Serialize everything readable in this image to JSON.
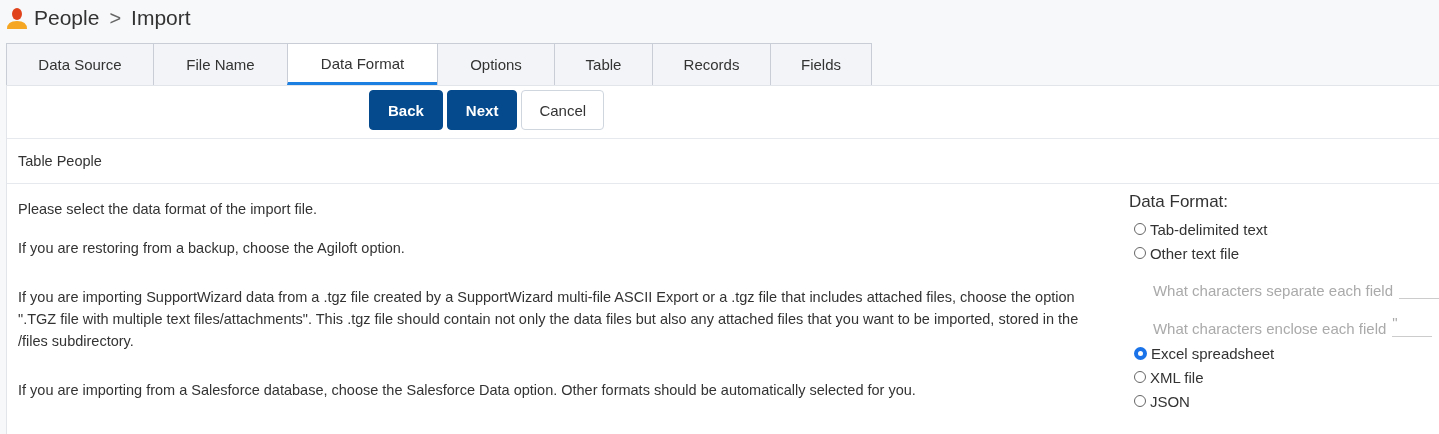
{
  "breadcrumb": {
    "section": "People",
    "separator": ">",
    "page": "Import"
  },
  "tabs": [
    {
      "label": "Data Source",
      "selected": false
    },
    {
      "label": "File Name",
      "selected": false
    },
    {
      "label": "Data Format",
      "selected": true
    },
    {
      "label": "Options",
      "selected": false
    },
    {
      "label": "Table",
      "selected": false
    },
    {
      "label": "Records",
      "selected": false
    },
    {
      "label": "Fields",
      "selected": false
    }
  ],
  "buttons": [
    {
      "label": "Back",
      "kind": "primary"
    },
    {
      "label": "Next",
      "kind": "primary"
    },
    {
      "label": "Cancel",
      "kind": "secondary"
    }
  ],
  "table_heading": "Table People",
  "paragraphs": [
    "Please select the data format of the import file.",
    "If you are restoring from a backup, choose the Agiloft option.",
    "If you are importing SupportWizard data from a .tgz file created by a SupportWizard multi-file ASCII Export or a .tgz file that includes attached files, choose the option \".TGZ file with multiple text files/attachments\". This .tgz file should contain not only the data files but also any attached files that you want to be imported, stored in the /files subdirectory.",
    "If you are importing from a Salesforce database, choose the Salesforce Data option. Other formats should be automatically selected for you."
  ],
  "data_format": {
    "title": "Data Format:",
    "options": [
      {
        "kind": "radio",
        "label": "Tab-delimited text",
        "selected": false
      },
      {
        "kind": "radio",
        "label": "Other text file",
        "selected": false
      },
      {
        "kind": "field",
        "label": "What characters separate each field",
        "disabled": true
      },
      {
        "kind": "field",
        "label": "What characters enclose each field",
        "value": "\"",
        "disabled": true
      },
      {
        "kind": "radio",
        "label": "Excel spreadsheet",
        "selected": true
      },
      {
        "kind": "radio",
        "label": "XML file",
        "selected": false
      },
      {
        "kind": "radio",
        "label": "JSON",
        "selected": false
      }
    ]
  }
}
